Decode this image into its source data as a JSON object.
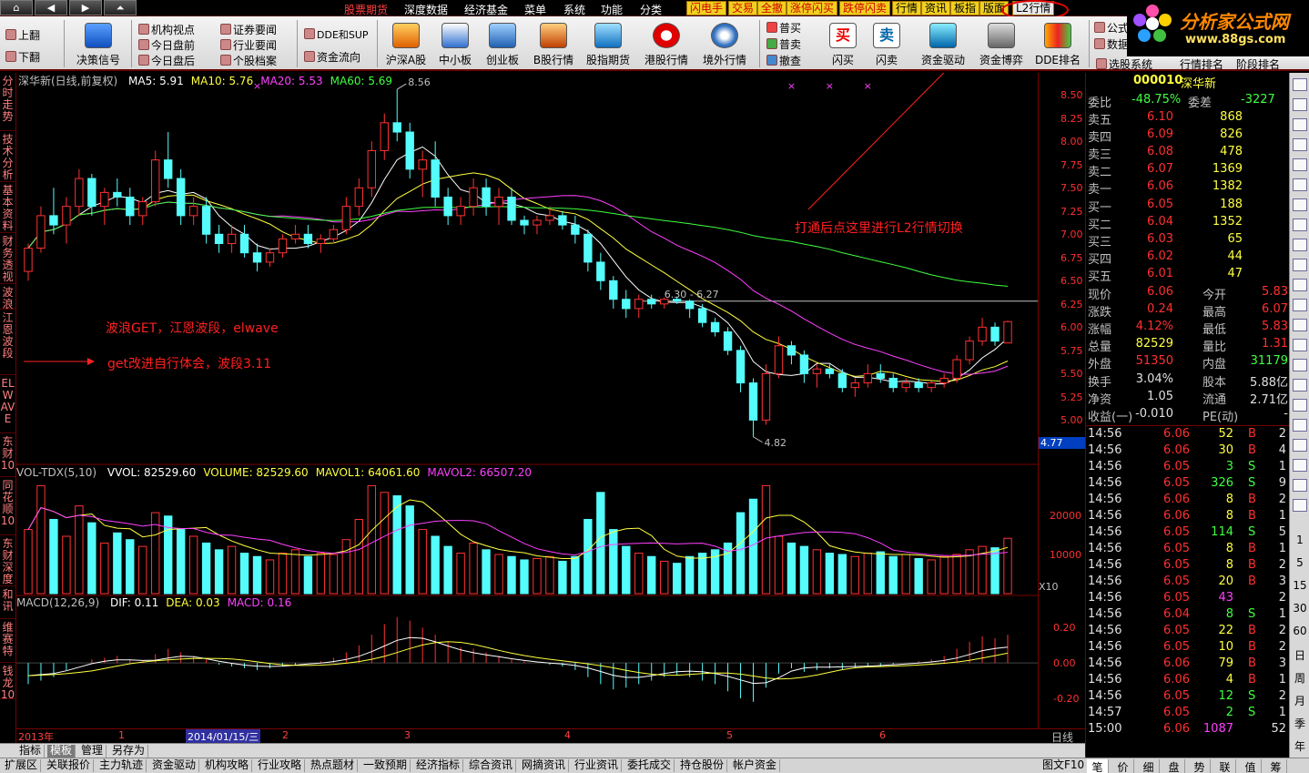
{
  "menu": {
    "nav_buttons": [
      "⌂",
      "◀",
      "▶",
      "⏶"
    ],
    "items": [
      "股票期货",
      "深度数据",
      "经济基金",
      "菜单",
      "系统",
      "功能",
      "分类"
    ],
    "quick": [
      "闪电手",
      "交易",
      "全撤",
      "涨停闪买",
      "跌停闪卖",
      "行情",
      "资讯",
      "板指",
      "版面",
      "L2行情"
    ]
  },
  "logo": {
    "main": "分析家公式网",
    "sub": "www.88gs.com"
  },
  "toolbar": {
    "page_up": "上翻",
    "page_down": "下翻",
    "decision": "决策信号",
    "small_col1": [
      "机构视点",
      "今日盘前",
      "今日盘后"
    ],
    "small_col2": [
      "证券要闻",
      "行业要闻",
      "个股档案"
    ],
    "small_col3": [
      "DDE和SUP",
      "资金流向"
    ],
    "big": [
      "沪深A股",
      "中小板",
      "创业板",
      "B股行情",
      "股指期货",
      "港股行情",
      "境外行情"
    ],
    "small_col4": [
      "普买",
      "普卖",
      "撤查"
    ],
    "big2": [
      "闪买",
      "闪卖",
      "资金驱动",
      "资金博弈",
      "DDE排名"
    ],
    "right_small": [
      "公式",
      "数据",
      "选股系统"
    ],
    "right_big": [
      "行情排名",
      "阶段排名"
    ]
  },
  "left_tabs": [
    "分时走势",
    "技术分析",
    "基本资料",
    "财务透视",
    "波浪",
    "江恩波段",
    "ELWAVE",
    "东财10",
    "同花顺10",
    "东财深度",
    "和讯",
    "维赛特",
    "钱龙10"
  ],
  "main_panel": {
    "title": "深华新(日线,前复权)",
    "ma": [
      {
        "label": "MA5: 5.91",
        "color": "#ffffff"
      },
      {
        "label": "MA10: 5.76",
        "color": "#ffff40"
      },
      {
        "label": "MA20: 5.53",
        "color": "#ff40ff"
      },
      {
        "label": "MA60: 5.69",
        "color": "#40ff40"
      }
    ],
    "high_label": "8.56",
    "low_label": "4.82",
    "line_label": "6.30 - 6.27",
    "last_price_tag": "4.77",
    "axis": [
      "8.50",
      "8.25",
      "8.00",
      "7.75",
      "7.50",
      "7.25",
      "7.00",
      "6.75",
      "6.50",
      "6.25",
      "6.00",
      "5.75",
      "5.50",
      "5.25",
      "5.00"
    ]
  },
  "vol_panel": {
    "title": "VOL-TDX(5,10)",
    "items": [
      {
        "label": "VVOL: 82529.60",
        "color": "#ffffff"
      },
      {
        "label": "VOLUME: 82529.60",
        "color": "#ffff40"
      },
      {
        "label": "MAVOL1: 64061.60",
        "color": "#ffff40"
      },
      {
        "label": "MAVOL2: 66507.20",
        "color": "#ff40ff"
      }
    ],
    "axis": [
      "20000",
      "10000"
    ],
    "unit": "X10"
  },
  "macd_panel": {
    "title": "MACD(12,26,9)",
    "items": [
      {
        "label": "DIF: 0.11",
        "color": "#ffffff"
      },
      {
        "label": "DEA: 0.03",
        "color": "#ffff40"
      },
      {
        "label": "MACD: 0.16",
        "color": "#ff40ff"
      }
    ],
    "axis": [
      "0.20",
      "0.00",
      "-0.20"
    ]
  },
  "annotations": {
    "l2": "打通后点这里进行L2行情切换",
    "wave1": "波浪GET，江恩波段，elwave",
    "wave2": "get改进自行体会，波段3.11"
  },
  "dates": {
    "labels": [
      "2013年",
      "1",
      "2014/01/15/三",
      "2",
      "3",
      "4",
      "5",
      "6"
    ],
    "period": "日线"
  },
  "quote": {
    "code": "000010",
    "name": "深华新",
    "weibi_label": "委比",
    "weibi": "-48.75%",
    "weicha_label": "委差",
    "weicha": "-3227",
    "asks": [
      {
        "label": "卖五",
        "price": "6.10",
        "vol": "868"
      },
      {
        "label": "卖四",
        "price": "6.09",
        "vol": "826"
      },
      {
        "label": "卖三",
        "price": "6.08",
        "vol": "478"
      },
      {
        "label": "卖二",
        "price": "6.07",
        "vol": "1369"
      },
      {
        "label": "卖一",
        "price": "6.06",
        "vol": "1382"
      }
    ],
    "bids": [
      {
        "label": "买一",
        "price": "6.05",
        "vol": "188"
      },
      {
        "label": "买二",
        "price": "6.04",
        "vol": "1352"
      },
      {
        "label": "买三",
        "price": "6.03",
        "vol": "65"
      },
      {
        "label": "买四",
        "price": "6.02",
        "vol": "44"
      },
      {
        "label": "买五",
        "price": "6.01",
        "vol": "47"
      }
    ],
    "stats": [
      {
        "l1": "现价",
        "v1": "6.06",
        "l2": "今开",
        "v2": "5.83"
      },
      {
        "l1": "涨跌",
        "v1": "0.24",
        "l2": "最高",
        "v2": "6.07"
      },
      {
        "l1": "涨幅",
        "v1": "4.12%",
        "l2": "最低",
        "v2": "5.83"
      },
      {
        "l1": "总量",
        "v1": "82529",
        "l2": "量比",
        "v2": "1.31"
      },
      {
        "l1": "外盘",
        "v1": "51350",
        "l2": "内盘",
        "v2": "31179"
      }
    ],
    "stats2": [
      {
        "l1": "换手",
        "v1": "3.04%",
        "l2": "股本",
        "v2": "5.88亿"
      },
      {
        "l1": "净资",
        "v1": "1.05",
        "l2": "流通",
        "v2": "2.71亿"
      },
      {
        "l1": "收益(一)",
        "v1": "-0.010",
        "l2": "PE(动)",
        "v2": "-"
      }
    ]
  },
  "ticks": [
    {
      "t": "14:56",
      "p": "6.06",
      "v": "52",
      "bs": "B",
      "n": "2"
    },
    {
      "t": "14:56",
      "p": "6.06",
      "v": "30",
      "bs": "B",
      "n": "4"
    },
    {
      "t": "14:56",
      "p": "6.05",
      "v": "3",
      "bs": "S",
      "n": "1"
    },
    {
      "t": "14:56",
      "p": "6.05",
      "v": "326",
      "bs": "S",
      "n": "9"
    },
    {
      "t": "14:56",
      "p": "6.06",
      "v": "8",
      "bs": "B",
      "n": "2"
    },
    {
      "t": "14:56",
      "p": "6.06",
      "v": "8",
      "bs": "B",
      "n": "1"
    },
    {
      "t": "14:56",
      "p": "6.05",
      "v": "114",
      "bs": "S",
      "n": "5"
    },
    {
      "t": "14:56",
      "p": "6.05",
      "v": "8",
      "bs": "B",
      "n": "1"
    },
    {
      "t": "14:56",
      "p": "6.05",
      "v": "8",
      "bs": "B",
      "n": "2"
    },
    {
      "t": "14:56",
      "p": "6.05",
      "v": "20",
      "bs": "B",
      "n": "3"
    },
    {
      "t": "14:56",
      "p": "6.05",
      "v": "43",
      "bs": "",
      "n": "2"
    },
    {
      "t": "14:56",
      "p": "6.04",
      "v": "8",
      "bs": "S",
      "n": "1"
    },
    {
      "t": "14:56",
      "p": "6.05",
      "v": "22",
      "bs": "B",
      "n": "2"
    },
    {
      "t": "14:56",
      "p": "6.05",
      "v": "10",
      "bs": "B",
      "n": "2"
    },
    {
      "t": "14:56",
      "p": "6.06",
      "v": "79",
      "bs": "B",
      "n": "3"
    },
    {
      "t": "14:56",
      "p": "6.06",
      "v": "4",
      "bs": "B",
      "n": "1"
    },
    {
      "t": "14:56",
      "p": "6.05",
      "v": "12",
      "bs": "S",
      "n": "2"
    },
    {
      "t": "14:57",
      "p": "6.05",
      "v": "2",
      "bs": "S",
      "n": "1"
    },
    {
      "t": "15:00",
      "p": "6.06",
      "v": "1087",
      "bs": "",
      "n": "52"
    }
  ],
  "side_periods": [
    "1",
    "5",
    "15",
    "30",
    "60",
    "日",
    "周",
    "月",
    "季",
    "年"
  ],
  "bottom_tabs1": [
    "指标",
    "模板",
    "管理",
    "另存为"
  ],
  "bottom_tabs2": [
    "扩展区",
    "关联报价",
    "主力轨迹",
    "资金驱动",
    "机构攻略",
    "行业攻略",
    "热点题材",
    "一致预期",
    "经济指标",
    "综合资讯",
    "网摘资讯",
    "行业资讯",
    "委托成交",
    "持仓股份",
    "帐户资金"
  ],
  "bottom_right_label": "图文F10",
  "right_tabs": [
    "笔",
    "价",
    "细",
    "盘",
    "势",
    "联",
    "值",
    "筹"
  ],
  "colors": {
    "up": "#ff3232",
    "down": "#54fcfc",
    "ma5": "#ffffff",
    "ma10": "#ffff40",
    "ma20": "#ff40ff",
    "ma60": "#40ff40",
    "axis": "#ff3030"
  },
  "chart_data": {
    "type": "candlestick",
    "price_range": [
      4.7,
      8.6
    ],
    "candles": [
      [
        6.6,
        6.9,
        6.5,
        6.85
      ],
      [
        6.85,
        7.3,
        6.8,
        7.2
      ],
      [
        7.2,
        7.5,
        7.0,
        7.1
      ],
      [
        7.1,
        7.4,
        6.9,
        7.3
      ],
      [
        7.3,
        7.7,
        7.2,
        7.6
      ],
      [
        7.6,
        7.65,
        7.2,
        7.3
      ],
      [
        7.3,
        7.5,
        7.1,
        7.45
      ],
      [
        7.45,
        7.6,
        7.3,
        7.4
      ],
      [
        7.4,
        7.5,
        7.1,
        7.2
      ],
      [
        7.2,
        7.4,
        7.1,
        7.35
      ],
      [
        7.35,
        7.9,
        7.3,
        7.8
      ],
      [
        7.8,
        8.1,
        7.5,
        7.6
      ],
      [
        7.6,
        7.7,
        7.1,
        7.2
      ],
      [
        7.2,
        7.4,
        7.1,
        7.3
      ],
      [
        7.3,
        7.4,
        6.9,
        7.0
      ],
      [
        7.0,
        7.1,
        6.8,
        6.9
      ],
      [
        6.9,
        7.1,
        6.8,
        7.0
      ],
      [
        7.0,
        7.1,
        6.75,
        6.8
      ],
      [
        6.8,
        6.9,
        6.6,
        6.7
      ],
      [
        6.7,
        6.85,
        6.65,
        6.8
      ],
      [
        6.8,
        7.0,
        6.75,
        6.95
      ],
      [
        6.95,
        7.1,
        6.9,
        7.0
      ],
      [
        7.0,
        7.1,
        6.85,
        6.9
      ],
      [
        6.9,
        7.0,
        6.8,
        6.95
      ],
      [
        6.95,
        7.1,
        6.9,
        7.05
      ],
      [
        7.05,
        7.4,
        7.0,
        7.3
      ],
      [
        7.3,
        7.6,
        7.2,
        7.5
      ],
      [
        7.5,
        8.0,
        7.4,
        7.9
      ],
      [
        7.9,
        8.3,
        7.8,
        8.2
      ],
      [
        8.2,
        8.56,
        8.0,
        8.1
      ],
      [
        8.1,
        8.2,
        7.6,
        7.7
      ],
      [
        7.7,
        7.9,
        7.4,
        7.8
      ],
      [
        7.8,
        8.0,
        7.3,
        7.4
      ],
      [
        7.4,
        7.5,
        7.1,
        7.2
      ],
      [
        7.2,
        7.4,
        7.1,
        7.3
      ],
      [
        7.3,
        7.6,
        7.2,
        7.5
      ],
      [
        7.5,
        7.6,
        7.2,
        7.3
      ],
      [
        7.3,
        7.5,
        7.1,
        7.4
      ],
      [
        7.4,
        7.5,
        7.1,
        7.15
      ],
      [
        7.15,
        7.2,
        7.0,
        7.1
      ],
      [
        7.1,
        7.2,
        7.0,
        7.15
      ],
      [
        7.15,
        7.3,
        7.1,
        7.2
      ],
      [
        7.2,
        7.25,
        7.05,
        7.1
      ],
      [
        7.1,
        7.2,
        6.9,
        7.0
      ],
      [
        7.0,
        7.05,
        6.6,
        6.7
      ],
      [
        6.7,
        6.8,
        6.4,
        6.5
      ],
      [
        6.5,
        6.55,
        6.2,
        6.3
      ],
      [
        6.3,
        6.4,
        6.1,
        6.2
      ],
      [
        6.2,
        6.35,
        6.1,
        6.3
      ],
      [
        6.3,
        6.35,
        6.2,
        6.25
      ],
      [
        6.25,
        6.32,
        6.2,
        6.3
      ],
      [
        6.3,
        6.33,
        6.25,
        6.28
      ],
      [
        6.28,
        6.3,
        6.1,
        6.2
      ],
      [
        6.2,
        6.25,
        6.0,
        6.05
      ],
      [
        6.05,
        6.1,
        5.9,
        5.95
      ],
      [
        5.95,
        6.0,
        5.7,
        5.75
      ],
      [
        5.75,
        5.8,
        5.3,
        5.4
      ],
      [
        5.4,
        5.45,
        4.82,
        5.0
      ],
      [
        5.0,
        5.6,
        4.95,
        5.5
      ],
      [
        5.5,
        5.9,
        5.45,
        5.8
      ],
      [
        5.8,
        5.85,
        5.6,
        5.7
      ],
      [
        5.7,
        5.75,
        5.4,
        5.5
      ],
      [
        5.5,
        5.6,
        5.35,
        5.55
      ],
      [
        5.55,
        5.6,
        5.45,
        5.5
      ],
      [
        5.5,
        5.55,
        5.3,
        5.35
      ],
      [
        5.35,
        5.45,
        5.25,
        5.4
      ],
      [
        5.4,
        5.6,
        5.35,
        5.5
      ],
      [
        5.5,
        5.6,
        5.4,
        5.45
      ],
      [
        5.45,
        5.5,
        5.3,
        5.35
      ],
      [
        5.35,
        5.45,
        5.3,
        5.4
      ],
      [
        5.4,
        5.45,
        5.3,
        5.35
      ],
      [
        5.35,
        5.42,
        5.3,
        5.4
      ],
      [
        5.4,
        5.5,
        5.35,
        5.45
      ],
      [
        5.45,
        5.7,
        5.4,
        5.65
      ],
      [
        5.65,
        5.9,
        5.6,
        5.85
      ],
      [
        5.85,
        6.1,
        5.8,
        6.0
      ],
      [
        6.0,
        6.05,
        5.8,
        5.85
      ],
      [
        5.83,
        6.07,
        5.83,
        6.06
      ]
    ],
    "volumes": [
      95,
      160,
      110,
      85,
      130,
      105,
      75,
      90,
      80,
      70,
      120,
      115,
      95,
      85,
      75,
      65,
      70,
      60,
      55,
      50,
      60,
      65,
      55,
      60,
      58,
      80,
      110,
      160,
      150,
      145,
      130,
      95,
      85,
      70,
      60,
      75,
      65,
      58,
      55,
      50,
      52,
      55,
      48,
      55,
      110,
      150,
      95,
      70,
      60,
      55,
      48,
      45,
      55,
      60,
      65,
      75,
      120,
      140,
      160,
      85,
      75,
      70,
      65,
      60,
      58,
      55,
      60,
      62,
      55,
      58,
      52,
      50,
      55,
      58,
      65,
      70,
      68,
      82
    ],
    "macd": [
      -0.12,
      -0.1,
      -0.08,
      -0.04,
      0.0,
      0.02,
      0.03,
      0.04,
      0.02,
      0.01,
      0.05,
      0.08,
      0.06,
      0.04,
      0.02,
      -0.01,
      -0.02,
      -0.03,
      -0.04,
      -0.03,
      -0.02,
      -0.01,
      0.0,
      0.01,
      0.03,
      0.06,
      0.1,
      0.16,
      0.22,
      0.26,
      0.24,
      0.2,
      0.16,
      0.12,
      0.09,
      0.08,
      0.06,
      0.04,
      0.02,
      0.01,
      0.0,
      -0.01,
      -0.02,
      -0.04,
      -0.08,
      -0.12,
      -0.15,
      -0.14,
      -0.12,
      -0.1,
      -0.08,
      -0.07,
      -0.08,
      -0.1,
      -0.12,
      -0.16,
      -0.2,
      -0.22,
      -0.14,
      -0.06,
      -0.03,
      -0.05,
      -0.04,
      -0.03,
      -0.04,
      -0.03,
      -0.02,
      -0.02,
      -0.01,
      0.0,
      0.01,
      0.02,
      0.04,
      0.08,
      0.12,
      0.15,
      0.14,
      0.16
    ],
    "macd_range": [
      -0.35,
      0.3
    ]
  }
}
